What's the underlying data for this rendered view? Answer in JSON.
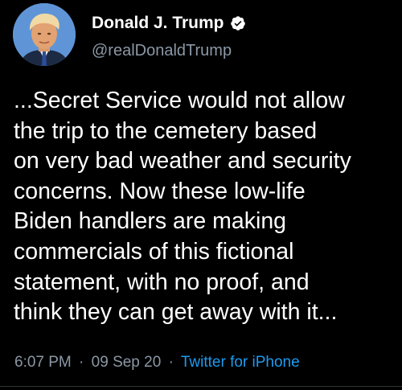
{
  "author": {
    "display_name": "Donald J. Trump",
    "handle": "@realDonaldTrump",
    "verified": true,
    "verified_icon": "verified-badge-icon"
  },
  "tweet": {
    "lines": [
      "...Secret Service would not allow",
      "the trip to the cemetery based",
      "on very bad weather and security",
      "concerns. Now these low-life",
      "Biden handlers are making",
      "commercials of this fictional",
      "statement, with no proof, and",
      "think they can get away with it..."
    ]
  },
  "meta": {
    "time": "6:07 PM",
    "separator": "·",
    "date": "09 Sep 20",
    "source": "Twitter for iPhone"
  },
  "colors": {
    "background": "#000000",
    "text": "#ffffff",
    "secondary_text": "#8b98a5",
    "link": "#1d9bf0"
  }
}
